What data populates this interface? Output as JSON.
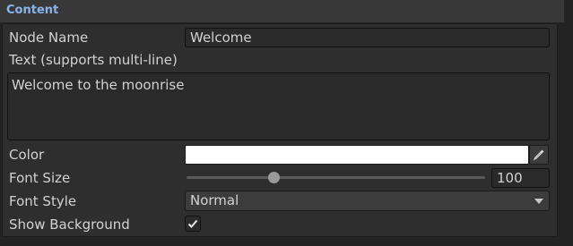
{
  "section": {
    "title": "Content"
  },
  "fields": {
    "node_name": {
      "label": "Node Name",
      "value": "Welcome"
    },
    "text": {
      "label": "Text (supports multi-line)",
      "value": "Welcome to the moonrise"
    },
    "color": {
      "label": "Color",
      "value": "#ffffff",
      "icon": "eyedropper-icon"
    },
    "font_size": {
      "label": "Font Size",
      "value": "100",
      "slider_fraction": 0.29
    },
    "font_style": {
      "label": "Font Style",
      "value": "Normal"
    },
    "show_background": {
      "label": "Show Background",
      "checked": true
    }
  },
  "colors": {
    "section_title": "#8ab4ec",
    "panel": "#2e2e2e",
    "field": "#2a2a2a"
  }
}
